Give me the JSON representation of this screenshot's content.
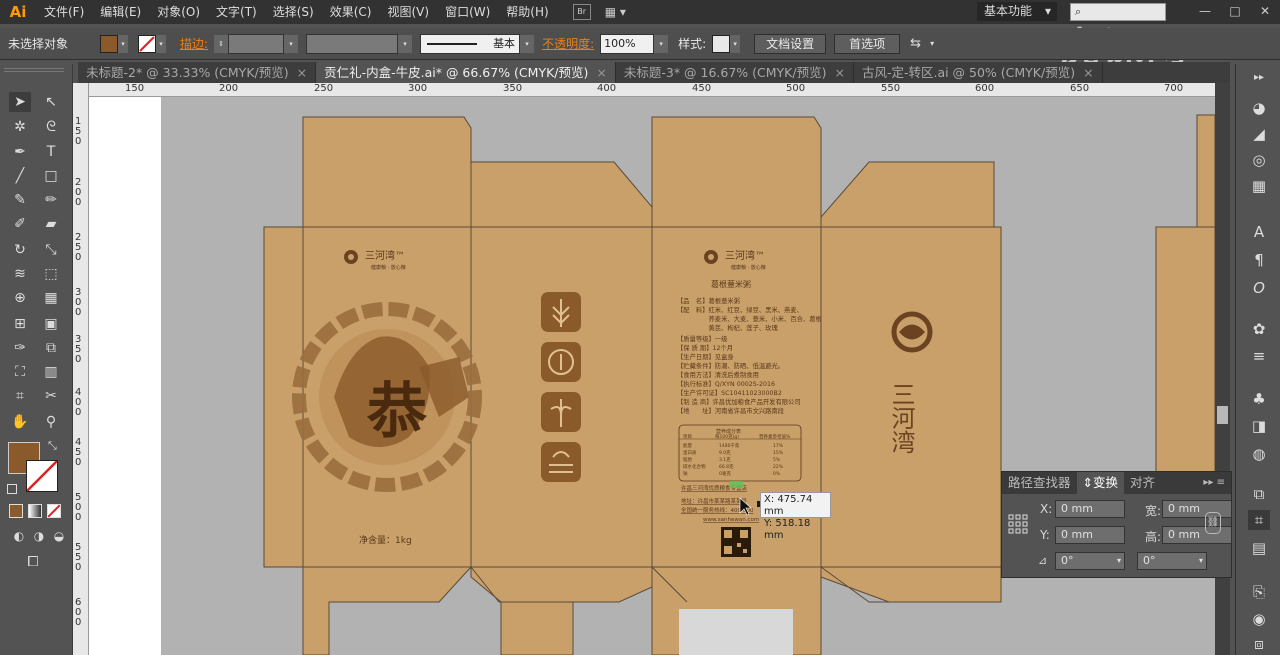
{
  "app": {
    "logo": "Ai"
  },
  "menu": [
    "文件(F)",
    "编辑(E)",
    "对象(O)",
    "文字(T)",
    "选择(S)",
    "效果(C)",
    "视图(V)",
    "窗口(W)",
    "帮助(H)"
  ],
  "menu_extra": {
    "br": "Br",
    "arrange_icon": "▦ ▾"
  },
  "workspace": {
    "label": "基本功能",
    "arrow": "▾"
  },
  "search": {
    "placeholder": "",
    "icon": "⌕"
  },
  "window_buttons": [
    "—",
    "□",
    "✕"
  ],
  "watermark": "虎课网",
  "control_bar": {
    "selection_status": "未选择对象",
    "fill_color": "#8a5a2b",
    "stroke_label": "描边:",
    "stroke_profile": "基本",
    "opacity_label": "不透明度:",
    "opacity_value": "100%",
    "style_label": "样式:",
    "doc_setup_button": "文档设置",
    "prefs_button": "首选项"
  },
  "tabs": [
    {
      "label": "未标题-2* @ 33.33% (CMYK/预览)",
      "close": "×",
      "active": false
    },
    {
      "label": "贡仁礼-内盒-牛皮.ai* @ 66.67% (CMYK/预览)",
      "close": "×",
      "active": true
    },
    {
      "label": "未标题-3* @ 16.67% (CMYK/预览)",
      "close": "×",
      "active": false
    },
    {
      "label": "古风-定-转区.ai @ 50% (CMYK/预览)",
      "close": "×",
      "active": false
    }
  ],
  "ruler_h": [
    "150",
    "200",
    "250",
    "300",
    "350",
    "400",
    "450",
    "500",
    "550",
    "600",
    "650",
    "700"
  ],
  "ruler_v": [
    "1 5 0",
    "2 0 0",
    "2 5 0",
    "3 0 0",
    "3 5 0",
    "4 0 0",
    "4 5 0",
    "5 0 0",
    "5 5 0",
    "6 0 0"
  ],
  "transform_panel": {
    "tabs": [
      "路径查找器",
      "变换",
      "对齐"
    ],
    "active_tab": "变换",
    "x_label": "X:",
    "x_value": "0 mm",
    "y_label": "Y:",
    "y_value": "0 mm",
    "w_label": "宽:",
    "w_value": "0 mm",
    "h_label": "高:",
    "h_value": "0 mm",
    "rotate_value": "0°",
    "shear_value": "0°",
    "menu_icon": "▸▸ ≡"
  },
  "tooltip": {
    "x": "X: 475.74 mm",
    "y": "Y: 518.18 mm"
  },
  "packaging": {
    "brand_cn": "三河湾",
    "brand_tm": "三河湾™",
    "brand_tagline": "健康粮 · 放心粮",
    "product_name": "葛根薏米粥",
    "big_char": "恭",
    "net_weight": "净含量：1kg",
    "spec_lines": [
      "【品　名】葛根薏米粥",
      "【配　料】红米、红豆、绿豆、黑米、燕麦、",
      "　　　　　荞麦米、大麦、薏米、小米、百合、葛根",
      "　　　　　黄芪、枸杞、莲子、玫瑰",
      "【质量等级】一级",
      "【保 质 期】12个月",
      "【生产日期】见盒身",
      "【贮藏条件】防潮、防晒、低温避光。",
      "【食用方法】清洗后煮制食用",
      "【执行标准】Q/XYN 0002S-2016",
      "【生产许可证】SC10411023000B2",
      "【制 造 商】许昌优加粮食产品开发有限公司",
      "【地　　址】河南省许昌市文兴路南段"
    ],
    "nutrition_title": "营养成分表",
    "nutrition_header": [
      "项目",
      "每100克(g)",
      "营养素参考值%"
    ],
    "nutrition_rows": [
      [
        "能量",
        "1480千焦",
        "17%"
      ],
      [
        "蛋白质",
        "9.0克",
        "15%"
      ],
      [
        "脂肪",
        "3.1克",
        "5%"
      ],
      [
        "碳水化合物",
        "66.8克",
        "22%"
      ],
      [
        "钠",
        "0毫克",
        "0%"
      ]
    ],
    "footer_lines": [
      "许昌三河湾优质粮食专营店",
      "地址：许昌市某某路某某号",
      "全国统一服务热线：400-000",
      "www.sanhewan.com"
    ]
  }
}
